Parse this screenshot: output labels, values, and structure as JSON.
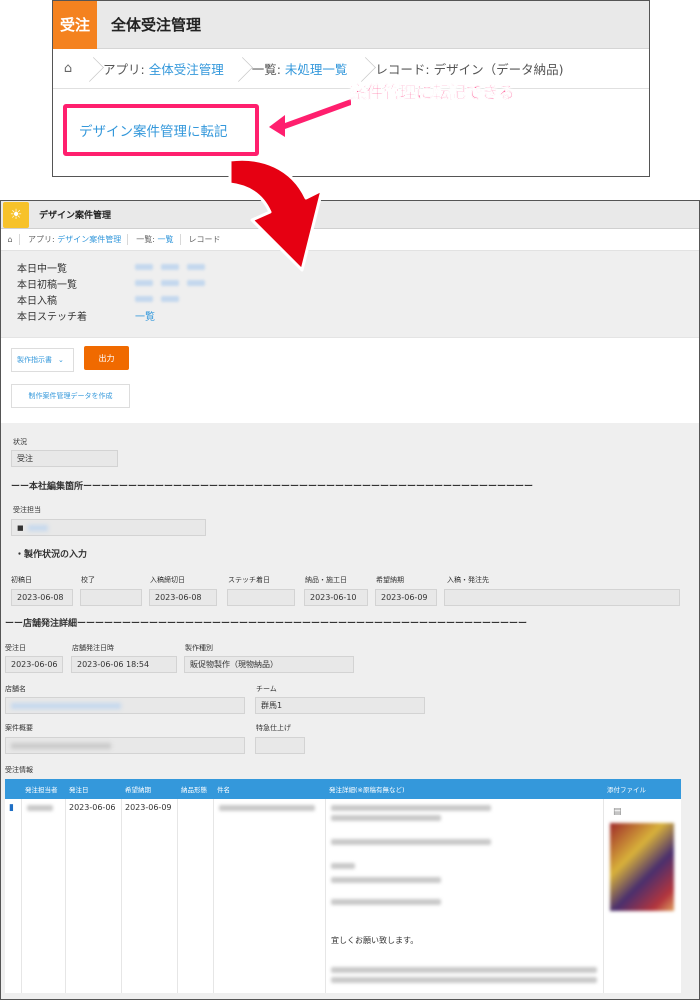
{
  "top": {
    "app_badge": "受注",
    "app_title": "全体受注管理",
    "breadcrumb": [
      {
        "prefix": "アプリ: ",
        "link": "全体受注管理"
      },
      {
        "prefix": "一覧: ",
        "link": "未処理一覧"
      },
      {
        "prefix": "レコード: デザイン（データ納品)",
        "link": ""
      }
    ],
    "transfer_link": "デザイン案件管理に転記",
    "callout": "案件管理に転記できる",
    "accent_color": "#ff1f6e"
  },
  "bottom": {
    "app_title": "デザイン案件管理",
    "breadcrumb": {
      "app_prefix": "アプリ: ",
      "app_link": "デザイン案件管理",
      "list_prefix": "一覧: ",
      "list_link": "一覧",
      "record_prefix": "レコード"
    },
    "lists": [
      {
        "label": "本日中一覧"
      },
      {
        "label": "本日初稿一覧"
      },
      {
        "label": "本日入稿"
      },
      {
        "label": "本日ステッチ着",
        "link": "一覧"
      }
    ],
    "toolbar": {
      "dropdown": "製作指示書",
      "output_button": "出力",
      "create_button": "制作案件管理データを作成"
    },
    "form": {
      "status_label": "状況",
      "status_value": "受注",
      "section_hq": "ーー本社編集箇所ーーーーーーーーーーーーーーーーーーーーーーーーーーーーーーーーーーーーーーーーーーーーーーーーーー",
      "assignee_label": "受注担当",
      "progress_title": "・製作状況の入力",
      "progress_fields": [
        {
          "label": "初稿日",
          "value": "2023-06-08"
        },
        {
          "label": "校了",
          "value": ""
        },
        {
          "label": "入稿締切日",
          "value": "2023-06-08"
        },
        {
          "label": "ステッチ着日",
          "value": ""
        },
        {
          "label": "納品・施工日",
          "value": "2023-06-10"
        },
        {
          "label": "希望納期",
          "value": "2023-06-09"
        },
        {
          "label": "入稿・発注先",
          "value": ""
        }
      ],
      "section_store": "ーー店舗発注詳細ーーーーーーーーーーーーーーーーーーーーーーーーーーーーーーーーーーーーーーーーーーーーーーーーーー",
      "order_date_label": "受注日",
      "order_date_value": "2023-06-06",
      "store_order_label": "店舗発注日時",
      "store_order_value": "2023-06-06 18:54",
      "product_type_label": "製作種別",
      "product_type_value": "販促物製作（現物納品）",
      "store_name_label": "店舗名",
      "team_label": "チーム",
      "team_value": "群馬1",
      "summary_label": "案件概要",
      "special_label": "特急仕上げ",
      "order_info_label": "受注情報"
    },
    "table": {
      "headers": [
        "発注担当者",
        "発注日",
        "希望納期",
        "納品形態",
        "件名",
        "発注詳細(※原稿有無など)",
        "添付ファイル"
      ],
      "row": {
        "order_date": "2023-06-06",
        "due_date": "2023-06-09",
        "detail_line": "宜しくお願い致します。"
      }
    }
  }
}
